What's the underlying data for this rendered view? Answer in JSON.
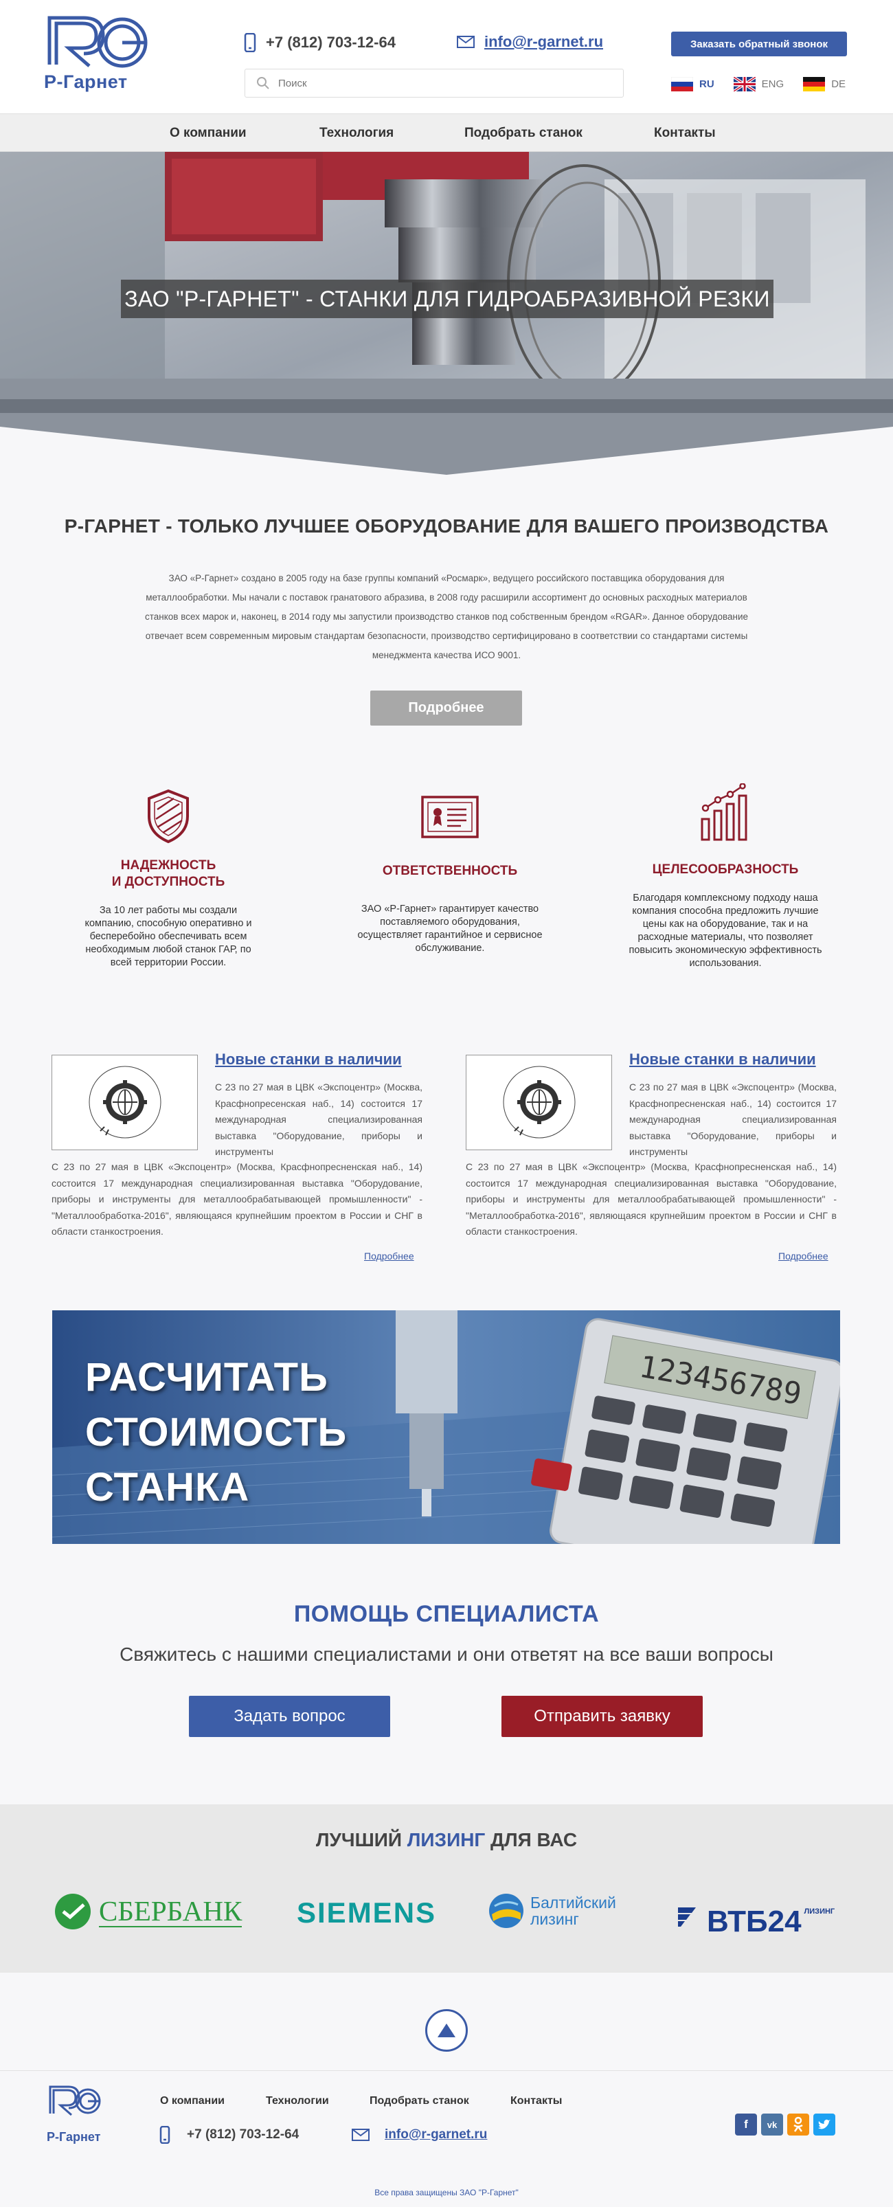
{
  "header": {
    "logo_text": "Р-Гарнет",
    "phone": "+7 (812) 703-12-64",
    "email": "info@r-garnet.ru",
    "search_placeholder": "Поиск",
    "callback_label": "Заказать обратный звонок",
    "langs": [
      {
        "code": "RU",
        "active": true
      },
      {
        "code": "ENG",
        "active": false
      },
      {
        "code": "DE",
        "active": false
      }
    ]
  },
  "nav": {
    "items": [
      "О компании",
      "Технология",
      "Подобрать станок",
      "Контакты"
    ]
  },
  "hero": {
    "title": "ЗАО \"Р-ГАРНЕТ\" - СТАНКИ ДЛЯ ГИДРОАБРАЗИВНОЙ РЕЗКИ"
  },
  "intro": {
    "title": "Р-ГАРНЕТ - ТОЛЬКО ЛУЧШЕЕ ОБОРУДОВАНИЕ ДЛЯ ВАШЕГО ПРОИЗВОДСТВА",
    "text": "ЗАО «Р-Гарнет» создано в 2005 году на базе группы компаний «Росмарк», ведущего российского поставщика оборудования для металлообработки. Мы начали с поставок гранатового абразива, в 2008 году расширили ассортимент до основных расходных материалов станков всех марок и, наконец, в 2014 году мы запустили производство станков под собственным брендом «RGAR». Данное оборудование отвечает всем современным мировым стандартам безопасности, производство сертифицировано в соответствии со стандартами системы менеджмента качества ИСО 9001.",
    "more_label": "Подробнее"
  },
  "features": [
    {
      "title_line1": "НАДЕЖНОСТЬ",
      "title_line2": "И ДОСТУПНОСТЬ",
      "text": "За 10 лет работы мы создали компанию, способную оперативно и бесперебойно обеспечивать всем необходимым любой станок ГАР, по всей территории России."
    },
    {
      "title_line1": "ОТВЕТСТВЕННОСТЬ",
      "title_line2": "",
      "text": "ЗАО «Р-Гарнет» гарантирует качество поставляемого оборудования, осуществляет гарантийное и сервисное обслуживание."
    },
    {
      "title_line1": "ЦЕЛЕСООБРАЗНОСТЬ",
      "title_line2": "",
      "text": "Благодаря комплексному подходу наша компания способна предложить лучшие цены как на оборудование, так и на расходные материалы, что позволяет повысить экономическую эффективность использования."
    }
  ],
  "news": [
    {
      "title": "Новые станки в наличии",
      "text1": "С 23 по 27 мая в ЦВК «Экспоцентр» (Москва, Красфнопресенская наб., 14) состоится 17 международная специализированная выставка \"Оборудование, приборы и инструменты",
      "text2": "С 23 по 27 мая в ЦВК «Экспоцентр» (Москва, Красфнопресненская наб., 14) состоится 17 международная специализированная выставка \"Оборудование, приборы и инструменты для металлообрабатывающей промышленности\" - \"Металлообработка-2016\", являющаяся крупнейшим проектом в России и СНГ в области станкостроения.",
      "more": "Подробнее",
      "logo_text": "МЕТАЛЛООБРАБОТКА • METALLOOBRABOTKA"
    },
    {
      "title": "Новые станки в наличии",
      "text1": "С 23 по 27 мая в ЦВК «Экспоцентр» (Москва, Красфнопресненская наб., 14) состоится 17 международная специализированная выставка \"Оборудование, приборы и инструменты",
      "text2": "С 23 по 27 мая в ЦВК «Экспоцентр» (Москва, Красфнопресненская наб., 14) состоится 17 международная специализированная выставка \"Оборудование, приборы и инструменты для металлообрабатывающей промышленности\" - \"Металлообработка-2016\", являющаяся крупнейшим проектом в России и СНГ в области станкостроения.",
      "more": "Подробнее",
      "logo_text": "МЕТАЛЛООБРАБОТКА • METALLOOBRABOTKA"
    }
  ],
  "calc": {
    "line1": "РАСЧИТАТЬ",
    "line2": "СТОИМОСТЬ",
    "line3": "СТАНКА",
    "display": "123456789"
  },
  "help": {
    "title": "ПОМОЩЬ СПЕЦИАЛИСТА",
    "subtitle": "Свяжитесь с нашими специалистами и они ответят на все ваши вопросы",
    "ask_label": "Задать вопрос",
    "send_label": "Отправить заявку"
  },
  "leasing": {
    "title_pre": "ЛУЧШИЙ ",
    "title_hl": "ЛИЗИНГ",
    "title_post": " ДЛЯ ВАС",
    "partners": {
      "sber": "СБЕРБАНК",
      "siemens": "SIEMENS",
      "baltic1": "Балтийский",
      "baltic2": "лизинг",
      "vtb": "ВТБ24",
      "vtb_small": "ЛИЗИНГ"
    }
  },
  "footer": {
    "logo_text": "Р-Гарнет",
    "nav": [
      "О компании",
      "Технологии",
      "Подобрать станок",
      "Контакты"
    ],
    "phone": "+7 (812) 703-12-64",
    "email": "info@r-garnet.ru",
    "copyright": "Все права защищены ЗАО \"Р-Гарнет\""
  },
  "colors": {
    "brand_blue": "#3a5aa6",
    "brand_red": "#8d1d2c",
    "button_red": "#991d27"
  }
}
